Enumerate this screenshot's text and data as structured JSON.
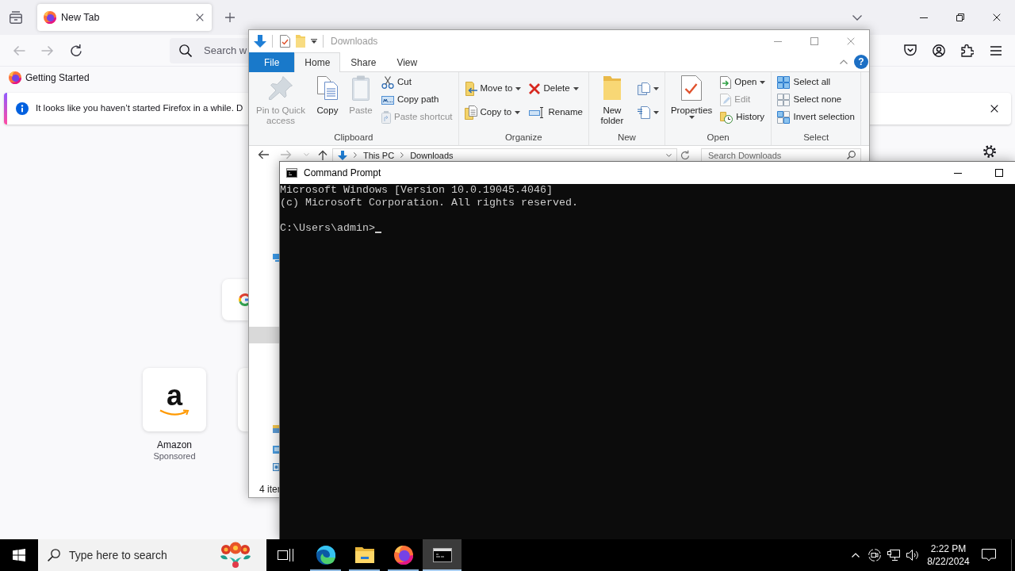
{
  "browser": {
    "tabs": [
      {
        "title": "New Tab",
        "selected": true
      }
    ],
    "nav_buttons": [
      {
        "disabled": true
      },
      {
        "disabled": true
      },
      {
        "disabled": false
      }
    ],
    "url_bar": {
      "placeholder": "Search w"
    },
    "bookmarks": [
      {
        "label": "Getting Started"
      }
    ],
    "notification": {
      "text": "It looks like you haven’t started Firefox in a while. D"
    },
    "shortcuts": [
      {
        "logo": "a",
        "title": "Amazon",
        "label": "Sponsored"
      }
    ]
  },
  "explorer": {
    "title": "Downloads",
    "active": false,
    "ribbon_tabs": [
      {
        "label": "File",
        "kind": "file",
        "selected": false
      },
      {
        "label": "Home",
        "kind": "tab",
        "selected": true
      },
      {
        "label": "Share",
        "kind": "tab",
        "selected": false
      },
      {
        "label": "View",
        "kind": "tab",
        "selected": false
      }
    ],
    "help_label": "?",
    "ribbon_groups": [
      {
        "label": "Clipboard",
        "columns": [
          [
            {
              "kind": "large",
              "label": "Pin to Quick access",
              "dropdown": false,
              "disabled": true
            }
          ],
          [
            {
              "kind": "large",
              "label": "Copy",
              "dropdown": false,
              "disabled": false
            }
          ],
          [
            {
              "kind": "large",
              "label": "Paste",
              "dropdown": false,
              "disabled": true
            }
          ],
          [
            {
              "kind": "small",
              "label": "Cut",
              "dropdown": false,
              "disabled": false
            },
            {
              "kind": "small",
              "label": "Copy path",
              "dropdown": false,
              "disabled": false
            },
            {
              "kind": "small",
              "label": "Paste shortcut",
              "dropdown": false,
              "disabled": true
            }
          ]
        ]
      },
      {
        "label": "Organize",
        "columns": [
          [
            {
              "kind": "small",
              "label": "Move to",
              "dropdown": true,
              "disabled": false
            },
            {
              "kind": "small",
              "label": "Copy to",
              "dropdown": true,
              "disabled": false
            }
          ],
          [
            {
              "kind": "small",
              "label": "Delete",
              "dropdown": true,
              "disabled": false
            },
            {
              "kind": "small",
              "label": "Rename",
              "dropdown": false,
              "disabled": false
            }
          ]
        ]
      },
      {
        "label": "New",
        "columns": [
          [
            {
              "kind": "large",
              "label": "New folder",
              "dropdown": false,
              "disabled": false
            }
          ],
          [
            {
              "kind": "icon",
              "dropdown": true,
              "disabled": false
            },
            {
              "kind": "icon",
              "dropdown": true,
              "disabled": false
            }
          ]
        ]
      },
      {
        "label": "Open",
        "columns": [
          [
            {
              "kind": "large",
              "label": "Properties",
              "dropdown": true,
              "disabled": false
            }
          ],
          [
            {
              "kind": "small",
              "label": "Open",
              "dropdown": true,
              "disabled": false
            },
            {
              "kind": "small",
              "label": "Edit",
              "dropdown": false,
              "disabled": true
            },
            {
              "kind": "small",
              "label": "History",
              "dropdown": false,
              "disabled": false
            }
          ]
        ]
      },
      {
        "label": "Select",
        "columns": [
          [
            {
              "kind": "small",
              "label": "Select all",
              "dropdown": false,
              "disabled": false
            },
            {
              "kind": "small",
              "label": "Select none",
              "dropdown": false,
              "disabled": false
            },
            {
              "kind": "small",
              "label": "Invert selection",
              "dropdown": false,
              "disabled": false
            }
          ]
        ]
      }
    ],
    "nav_buttons": [
      {
        "disabled": false
      },
      {
        "disabled": true
      },
      {
        "disabled": true
      },
      {
        "disabled": false
      }
    ],
    "address": [
      "This PC",
      "Downloads"
    ],
    "search": {
      "placeholder": "Search Downloads"
    },
    "status": "4 iter"
  },
  "console": {
    "title": "Command Prompt",
    "output": [
      "Microsoft Windows [Version 10.0.19045.4046]",
      "(c) Microsoft Corporation. All rights reserved."
    ],
    "prompt": "C:\\Users\\admin>",
    "cursor": true
  },
  "taskbar": {
    "search": {
      "placeholder": "Type here to search"
    },
    "apps": [
      {
        "running": true,
        "selected": false
      },
      {
        "running": true,
        "selected": false
      },
      {
        "running": true,
        "selected": false
      },
      {
        "running": true,
        "selected": true
      }
    ],
    "clock": {
      "time": "2:22 PM",
      "date": "8/22/2024"
    }
  }
}
